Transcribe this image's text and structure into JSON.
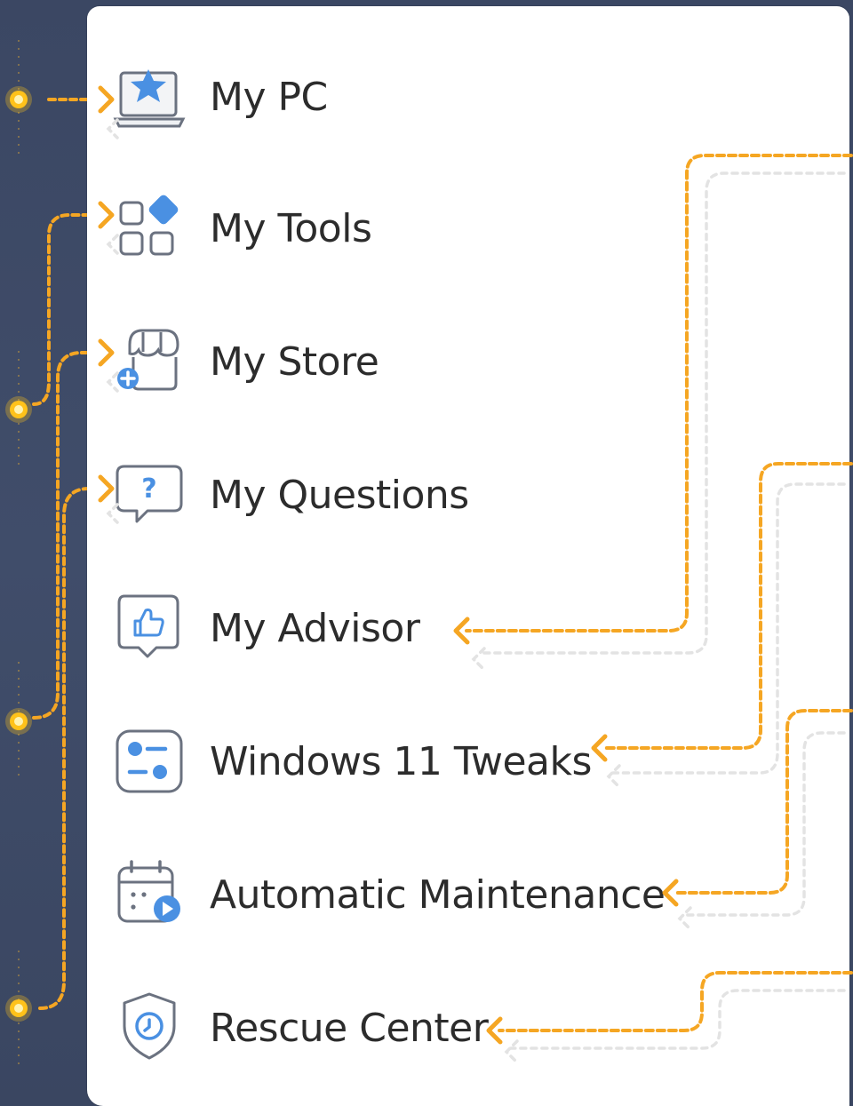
{
  "menu": {
    "items": [
      {
        "id": "my-pc",
        "label": "My PC",
        "icon": "laptop-star-icon"
      },
      {
        "id": "my-tools",
        "label": "My Tools",
        "icon": "apps-grid-icon"
      },
      {
        "id": "my-store",
        "label": "My Store",
        "icon": "store-add-icon"
      },
      {
        "id": "my-questions",
        "label": "My Questions",
        "icon": "question-bubble-icon"
      },
      {
        "id": "my-advisor",
        "label": "My Advisor",
        "icon": "thumbs-up-bubble-icon"
      },
      {
        "id": "windows-11-tweaks",
        "label": "Windows 11 Tweaks",
        "icon": "toggle-settings-icon"
      },
      {
        "id": "automatic-maintenance",
        "label": "Automatic Maintenance",
        "icon": "calendar-play-icon"
      },
      {
        "id": "rescue-center",
        "label": "Rescue Center",
        "icon": "shield-clock-icon"
      }
    ]
  },
  "colors": {
    "background": "#3d4966",
    "panel": "#ffffff",
    "accent": "#f5a623",
    "node": "#ffc21a",
    "icon_blue": "#4a90e2",
    "icon_outline": "#6b7280",
    "ghost_line": "#e2e2e2"
  }
}
